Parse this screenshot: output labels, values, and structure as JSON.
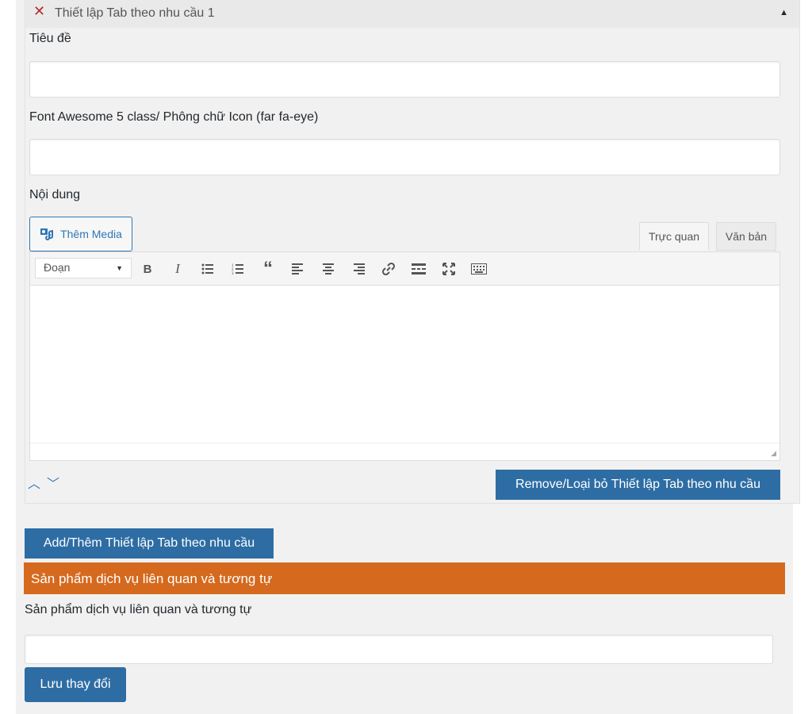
{
  "group": {
    "title": "Thiết lập Tab theo nhu cầu 1",
    "fields": {
      "title_label": "Tiêu đề",
      "title_value": "",
      "icon_label": "Font Awesome 5 class/ Phông chữ Icon (far fa-eye)",
      "icon_value": "",
      "content_label": "Nội dung"
    },
    "editor": {
      "add_media_label": "Thêm Media",
      "tab_visual": "Trực quan",
      "tab_text": "Văn bản",
      "format_select": "Đoạn"
    },
    "remove_button": "Remove/Loại bỏ Thiết lập Tab theo nhu cầu"
  },
  "add_button": "Add/Thêm Thiết lập Tab theo nhu cầu",
  "related": {
    "section_title": "Sản phẩm dịch vụ liên quan và tương tự",
    "field_label": "Sản phẩm dịch vụ liên quan và tương tự",
    "field_value": ""
  },
  "save_button": "Lưu thay đổi",
  "colors": {
    "primary": "#2e6da4",
    "section_bar": "#d5691e",
    "close": "#b32d2e"
  }
}
